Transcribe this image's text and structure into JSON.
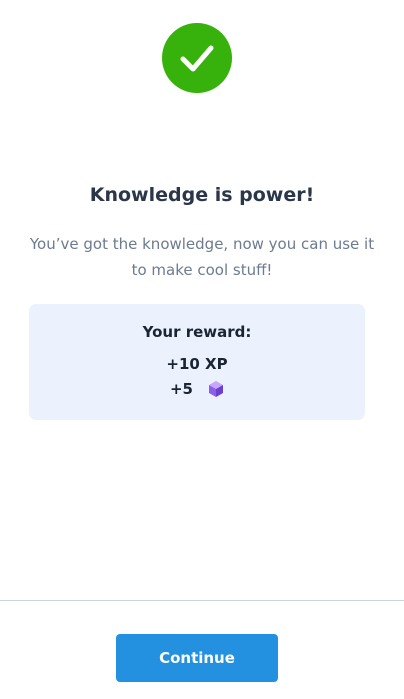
{
  "success_icon": {
    "name": "checkmark-icon",
    "color": "#37b10b"
  },
  "title": "Knowledge is power!",
  "subtitle": "You’ve got the knowledge, now you can use it to make cool stuff!",
  "reward": {
    "heading": "Your reward:",
    "xp": "+10 XP",
    "gems": "+5",
    "gem_icon": "gem-icon"
  },
  "footer": {
    "continue_label": "Continue",
    "button_color": "#2490e0"
  }
}
